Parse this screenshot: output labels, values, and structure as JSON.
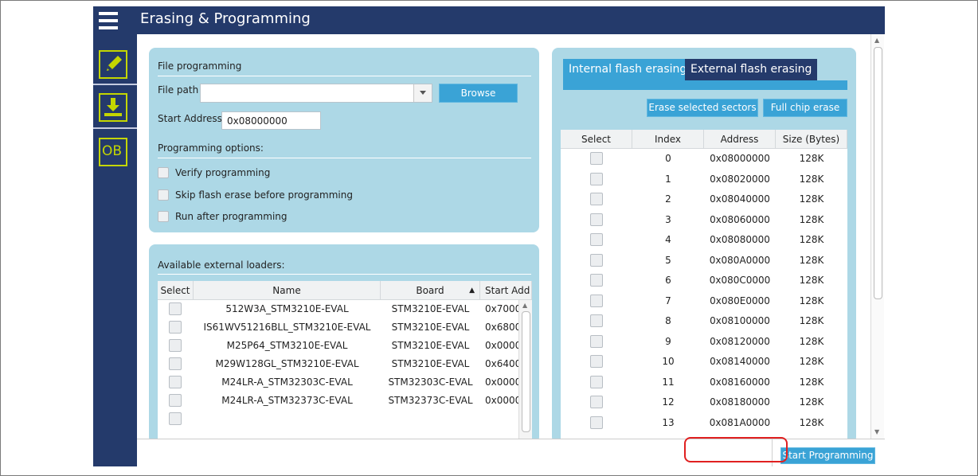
{
  "app": {
    "title": "Erasing & Programming",
    "accent": "#3aa3d6",
    "titlebar_color": "#243a6b",
    "panel_color": "#add8e6",
    "highlight_color": "#e02020"
  },
  "sidebar": {
    "items": [
      {
        "name": "pencil-icon",
        "label": ""
      },
      {
        "name": "download-icon",
        "label": ""
      },
      {
        "name": "option-bytes",
        "label": "OB"
      }
    ]
  },
  "file_programming": {
    "title": "File programming",
    "file_path_label": "File path",
    "file_path_value": "",
    "browse_label": "Browse",
    "start_address_label": "Start Address",
    "start_address_value": "0x08000000",
    "options_title": "Programming options:",
    "options": [
      {
        "label": "Verify programming",
        "checked": false
      },
      {
        "label": "Skip flash erase before programming",
        "checked": false
      },
      {
        "label": "Run after programming",
        "checked": false
      }
    ]
  },
  "loaders": {
    "title": "Available external loaders:",
    "columns": [
      "Select",
      "Name",
      "Board",
      "Start Add"
    ],
    "sort_indicator": "▲",
    "rows": [
      {
        "name": "512W3A_STM3210E-EVAL",
        "board": "STM3210E-EVAL",
        "start": "0x7000"
      },
      {
        "name": "IS61WV51216BLL_STM3210E-EVAL",
        "board": "STM3210E-EVAL",
        "start": "0x6800"
      },
      {
        "name": "M25P64_STM3210E-EVAL",
        "board": "STM3210E-EVAL",
        "start": "0x0000"
      },
      {
        "name": "M29W128GL_STM3210E-EVAL",
        "board": "STM3210E-EVAL",
        "start": "0x6400"
      },
      {
        "name": "M24LR-A_STM32303C-EVAL",
        "board": "STM32303C-EVAL",
        "start": "0x0000"
      },
      {
        "name": "M24LR-A_STM32373C-EVAL",
        "board": "STM32373C-EVAL",
        "start": "0x0000"
      }
    ]
  },
  "erasing": {
    "tabs": [
      {
        "label": "Internal flash erasing",
        "active": true
      },
      {
        "label": "External flash erasing",
        "active": false
      }
    ],
    "erase_selected_label": "Erase selected sectors",
    "full_chip_label": "Full chip erase",
    "columns": [
      "Select",
      "Index",
      "Address",
      "Size (Bytes)"
    ],
    "sectors": [
      {
        "index": "0",
        "address": "0x08000000",
        "size": "128K"
      },
      {
        "index": "1",
        "address": "0x08020000",
        "size": "128K"
      },
      {
        "index": "2",
        "address": "0x08040000",
        "size": "128K"
      },
      {
        "index": "3",
        "address": "0x08060000",
        "size": "128K"
      },
      {
        "index": "4",
        "address": "0x08080000",
        "size": "128K"
      },
      {
        "index": "5",
        "address": "0x080A0000",
        "size": "128K"
      },
      {
        "index": "6",
        "address": "0x080C0000",
        "size": "128K"
      },
      {
        "index": "7",
        "address": "0x080E0000",
        "size": "128K"
      },
      {
        "index": "8",
        "address": "0x08100000",
        "size": "128K"
      },
      {
        "index": "9",
        "address": "0x08120000",
        "size": "128K"
      },
      {
        "index": "10",
        "address": "0x08140000",
        "size": "128K"
      },
      {
        "index": "11",
        "address": "0x08160000",
        "size": "128K"
      },
      {
        "index": "12",
        "address": "0x08180000",
        "size": "128K"
      },
      {
        "index": "13",
        "address": "0x081A0000",
        "size": "128K"
      }
    ]
  },
  "bottom": {
    "log_value": "",
    "start_label": "Start Programming"
  }
}
